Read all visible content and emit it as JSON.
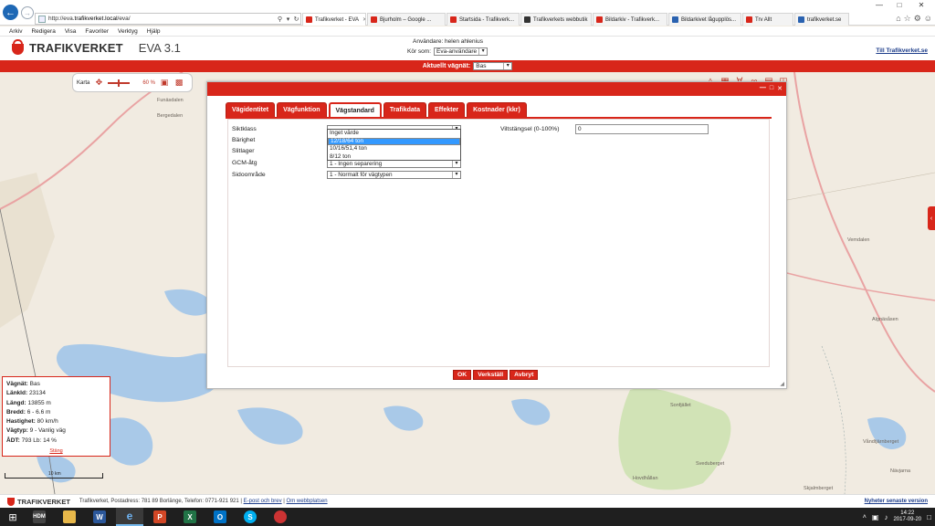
{
  "browser": {
    "url_prefix": "http://eva.",
    "url_domain": "trafikverket.local",
    "url_suffix": "/eva/",
    "tabs": [
      {
        "label": "Trafikverket - EVA",
        "color": "#d8261a",
        "active": true
      },
      {
        "label": "Bjurholm – Google ...",
        "color": "#d8261a",
        "active": false
      },
      {
        "label": "Startsida - Trafikverk...",
        "color": "#d8261a",
        "active": false
      },
      {
        "label": "Trafikverkets webbutik",
        "color": "#333333",
        "active": false
      },
      {
        "label": "Bildarkiv - Trafikverk...",
        "color": "#d8261a",
        "active": false
      },
      {
        "label": "Bildarkivet lågupplös...",
        "color": "#2a62b0",
        "active": false
      },
      {
        "label": "Trv Allt",
        "color": "#d8261a",
        "active": false
      },
      {
        "label": "trafikverket.se",
        "color": "#2a62b0",
        "active": false
      }
    ],
    "menu": [
      "Arkiv",
      "Redigera",
      "Visa",
      "Favoriter",
      "Verktyg",
      "Hjälp"
    ]
  },
  "header": {
    "logo_text": "TRAFIKVERKET",
    "app_name": "EVA 3.1",
    "user_label": "Användare: helen ahlenius",
    "run_as_label": "Kör som:",
    "run_as_value": "Eva-användare",
    "link_label": "Till Trafikverket.se",
    "network_label": "Aktuellt vägnät:",
    "network_value": "Bas"
  },
  "map": {
    "tools_label": "Karta",
    "zoom_label": "60 %",
    "places": [
      "Funäsdalen",
      "Bergedalen",
      "Vemdalen",
      "Sonfjället",
      "Sveduberget",
      "Hovdhållan",
      "Algnäsåsen",
      "Våndtjärnberget",
      "Nävjarna",
      "Skjalmberget"
    ]
  },
  "infobox": {
    "rows": [
      {
        "label": "Vägnät:",
        "value": "Bas"
      },
      {
        "label": "LänkId:",
        "value": "23134"
      },
      {
        "label": "Längd:",
        "value": "13855 m"
      },
      {
        "label": "Bredd:",
        "value": "6 - 6.6 m"
      },
      {
        "label": "Hastighet:",
        "value": "80 km/h"
      },
      {
        "label": "Vägtyp:",
        "value": "9 - Vanlig väg"
      },
      {
        "label": "ÅDT:",
        "value": "793 Lb: 14 %"
      }
    ],
    "close_label": "Stäng",
    "scale_label": "10 km"
  },
  "dialog": {
    "tabs": [
      {
        "label": "Vägidentitet",
        "active": false
      },
      {
        "label": "Vägfunktion",
        "active": false
      },
      {
        "label": "Vägstandard",
        "active": true
      },
      {
        "label": "Trafikdata",
        "active": false
      },
      {
        "label": "Effekter",
        "active": false
      },
      {
        "label": "Kostnader (kkr)",
        "active": false
      }
    ],
    "fields": {
      "siktklass": "Siktklass",
      "barighet": "Bärighet",
      "slitlager": "Slitlager",
      "gcm": "GCM-åtg",
      "gcm_value": "1 - Ingen separering",
      "sidoomrade": "Sidoområde",
      "sidoomrade_value": "1 - Normalt för vägtypen",
      "viltstangsel": "Viltstängsel (0-100%)",
      "viltstangsel_value": "0"
    },
    "dropdown_options": [
      {
        "label": "Inget värde",
        "selected": false
      },
      {
        "label": "12/18/64 ton",
        "selected": true
      },
      {
        "label": "10/16/51,4 ton",
        "selected": false
      },
      {
        "label": "8/12 ton",
        "selected": false
      }
    ],
    "buttons": {
      "ok": "OK",
      "apply": "Verkställ",
      "cancel": "Avbryt"
    }
  },
  "footer": {
    "logo_text": "TRAFIKVERKET",
    "address": "Trafikverket, Postadress: 781 89 Borlänge, Telefon: 0771-921 921",
    "email_link": "E-post och brev",
    "about_link": "Om webbplatsen",
    "news_link": "Nyheter senaste version"
  },
  "taskbar": {
    "time": "14:22",
    "date": "2017-09-20"
  },
  "colors": {
    "brand": "#d8261a",
    "map_bg": "#f1ebe1",
    "water": "#a9c9e8",
    "forest": "#d1e3b6"
  }
}
